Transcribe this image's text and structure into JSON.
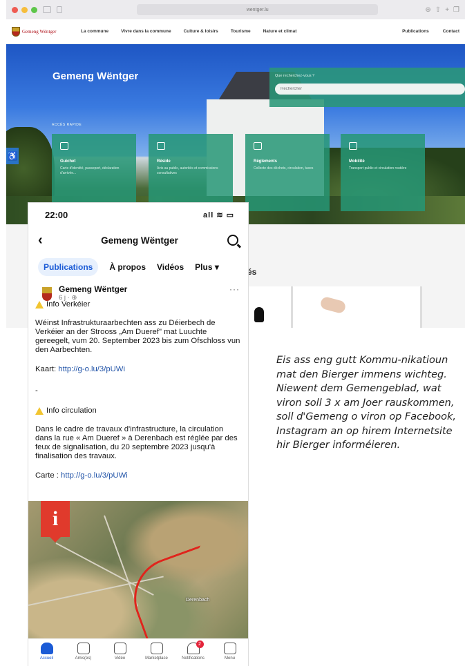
{
  "browser": {
    "url": "wentger.lu",
    "site_name": "Gemeng Wëntger",
    "nav": [
      "La commune",
      "Vivre dans la commune",
      "Culture & loisirs",
      "Tourisme",
      "Nature et climat"
    ],
    "nav_right": [
      "Publications",
      "Contact"
    ],
    "hero_title": "Gemeng Wëntger",
    "search_label": "Que recherchez-vous ?",
    "search_placeholder": "Rechercher",
    "quick_label": "ACCÈS RAPIDE",
    "tiles": [
      {
        "title": "Guichet",
        "sub": "Carte d'identité, passeport, déclaration d'arrivée..."
      },
      {
        "title": "Réside",
        "sub": "Avis au public, autorités et commissions consultatives"
      },
      {
        "title": "Règlements",
        "sub": "Collecte des déchets, circulation, taxes"
      },
      {
        "title": "Mobilité",
        "sub": "Transport public et circulation routière"
      }
    ],
    "section_fragment": "tés"
  },
  "phone": {
    "time": "22:00",
    "status_icons": "all ≋ ▭",
    "page_title": "Gemeng Wëntger",
    "tabs": [
      "Publications",
      "À propos",
      "Vidéos",
      "Plus ▾"
    ],
    "post": {
      "author": "Gemeng Wëntger",
      "meta": "6 j · ⊕",
      "more": "···",
      "heading_lu": "Info Verkéier",
      "text_lu": "Wéinst Infrastrukturaarbechten ass zu Déierbech de Verkéier an der Strooss „Am Dueref\" mat Luuchte gereegelt, vum 20. September 2023 bis zum Ofschloss vun den Aarbechten.",
      "map_label_lu": "Kaart:",
      "map_link_lu": "http://g-o.lu/3/pUWi",
      "separator": "-",
      "heading_fr": "Info circulation",
      "text_fr": "Dans le cadre de travaux d'infrastructure, la circulation dans la rue « Am Dueref » à Derenbach est réglée par des feux de signalisation, du 20 septembre 2023 jusqu'à finalisation des travaux.",
      "map_label_fr": "Carte :",
      "map_link_fr": "http://g-o.lu/3/pUWi",
      "map_place": "Derenbach",
      "pin_letter": "i"
    },
    "tabbar": [
      {
        "label": "Accueil",
        "icon": "home-icon"
      },
      {
        "label": "Amis(es)",
        "icon": "friends-icon"
      },
      {
        "label": "Vidéo",
        "icon": "video-icon"
      },
      {
        "label": "Marketplace",
        "icon": "marketplace-icon"
      },
      {
        "label": "Notifications",
        "icon": "bell-icon",
        "badge": "2"
      },
      {
        "label": "Menu",
        "icon": "menu-icon"
      }
    ]
  },
  "caption": "Eis ass eng gutt Kommu-nikatioun mat den Bierger immens wichteg. Niewent dem Gemengeblad, wat viron soll 3 x am Joer rauskommen, soll d'Gemeng o viron op Facebook, Instagram an op hirem Internetsite hir Bierger informéieren.",
  "colors": {
    "accent_green": "#26a07a",
    "facebook_blue": "#1b5bd6",
    "warning_yellow": "#f2c530",
    "route_red": "#e0241c"
  }
}
